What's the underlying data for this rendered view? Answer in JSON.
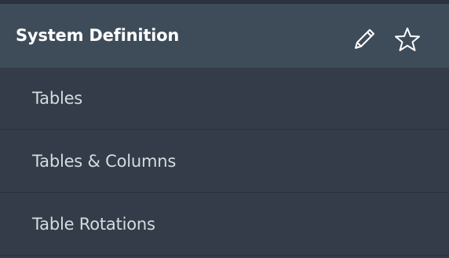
{
  "section": {
    "title": "System Definition",
    "edit_icon": "pencil-icon",
    "favorite_icon": "star-icon"
  },
  "menu": {
    "items": [
      {
        "label": "Tables"
      },
      {
        "label": "Tables & Columns"
      },
      {
        "label": "Table Rotations"
      }
    ]
  },
  "colors": {
    "header_background": "#3e4c5a",
    "item_background": "#333c48",
    "title_text": "#ffffff",
    "item_text": "#d6dbe0",
    "divider": "#2a323c"
  }
}
